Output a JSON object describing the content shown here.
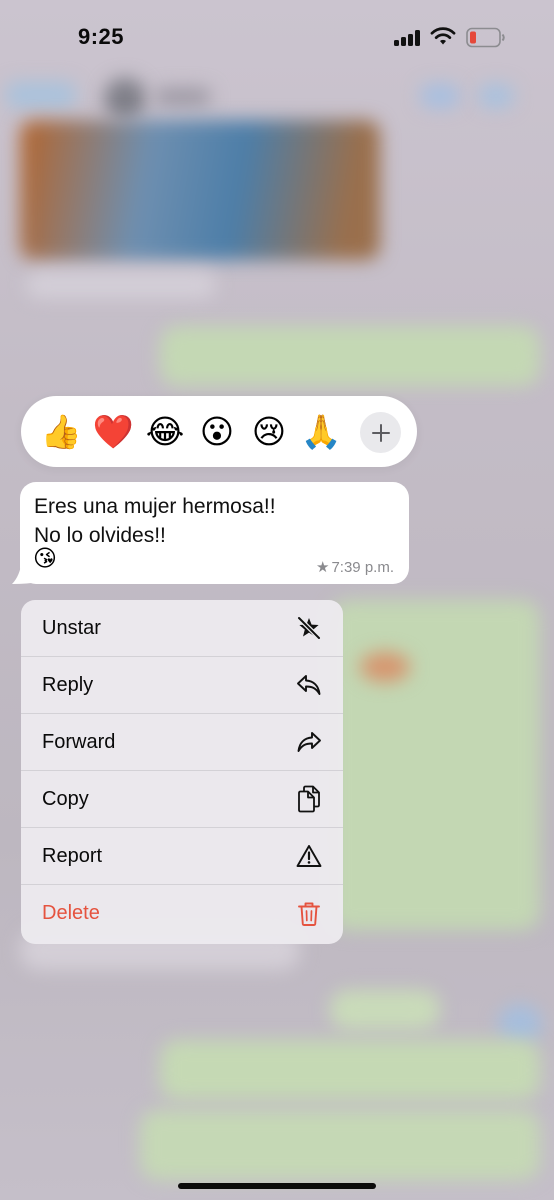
{
  "status_bar": {
    "time": "9:25",
    "signal_icon": "signal-bars-icon",
    "wifi_icon": "wifi-icon",
    "battery_icon": "battery-low-icon",
    "battery_color": "#e5483a"
  },
  "reactions": {
    "emojis": [
      "👍",
      "❤️",
      "😂",
      "😮",
      "😢",
      "🙏"
    ],
    "more_icon": "plus-icon"
  },
  "message": {
    "lines": [
      "Eres una mujer hermosa!!",
      "No lo olvides!!"
    ],
    "emoji": "😘",
    "star_icon": "★",
    "time": "7:39 p.m."
  },
  "menu": {
    "items": [
      {
        "label": "Unstar",
        "icon": "star-slash-icon"
      },
      {
        "label": "Reply",
        "icon": "reply-arrow-icon"
      },
      {
        "label": "Forward",
        "icon": "forward-arrow-icon"
      },
      {
        "label": "Copy",
        "icon": "copy-icon"
      },
      {
        "label": "Report",
        "icon": "warning-triangle-icon"
      },
      {
        "label": "Delete",
        "icon": "trash-icon",
        "color": "#e5533f"
      }
    ]
  }
}
